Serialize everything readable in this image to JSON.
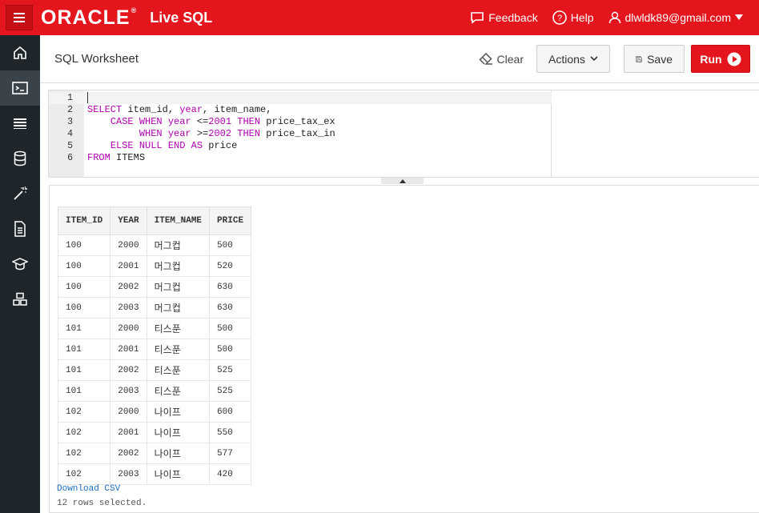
{
  "topbar": {
    "brand": "ORACLE",
    "product": "Live SQL",
    "feedback": "Feedback",
    "help": "Help",
    "user": "dlwldk89@gmail.com"
  },
  "header": {
    "title": "SQL Worksheet",
    "clear": "Clear",
    "actions": "Actions",
    "save": "Save",
    "run": "Run"
  },
  "editor": {
    "line_numbers": [
      "1",
      "2",
      "3",
      "4",
      "5",
      "6"
    ]
  },
  "results": {
    "columns": [
      "ITEM_ID",
      "YEAR",
      "ITEM_NAME",
      "PRICE"
    ],
    "rows": [
      [
        "100",
        "2000",
        "머그컵",
        "500"
      ],
      [
        "100",
        "2001",
        "머그컵",
        "520"
      ],
      [
        "100",
        "2002",
        "머그컵",
        "630"
      ],
      [
        "100",
        "2003",
        "머그컵",
        "630"
      ],
      [
        "101",
        "2000",
        "티스푼",
        "500"
      ],
      [
        "101",
        "2001",
        "티스푼",
        "500"
      ],
      [
        "101",
        "2002",
        "티스푼",
        "525"
      ],
      [
        "101",
        "2003",
        "티스푼",
        "525"
      ],
      [
        "102",
        "2000",
        "나이프",
        "600"
      ],
      [
        "102",
        "2001",
        "나이프",
        "550"
      ],
      [
        "102",
        "2002",
        "나이프",
        "577"
      ],
      [
        "102",
        "2003",
        "나이프",
        "420"
      ]
    ],
    "download": "Download CSV",
    "rowcount": "12 rows selected."
  },
  "colors": {
    "brand_red": "#e4151c",
    "sidebar": "#1f262b",
    "keyword": "#b000b0",
    "link": "#1a6fc4"
  }
}
